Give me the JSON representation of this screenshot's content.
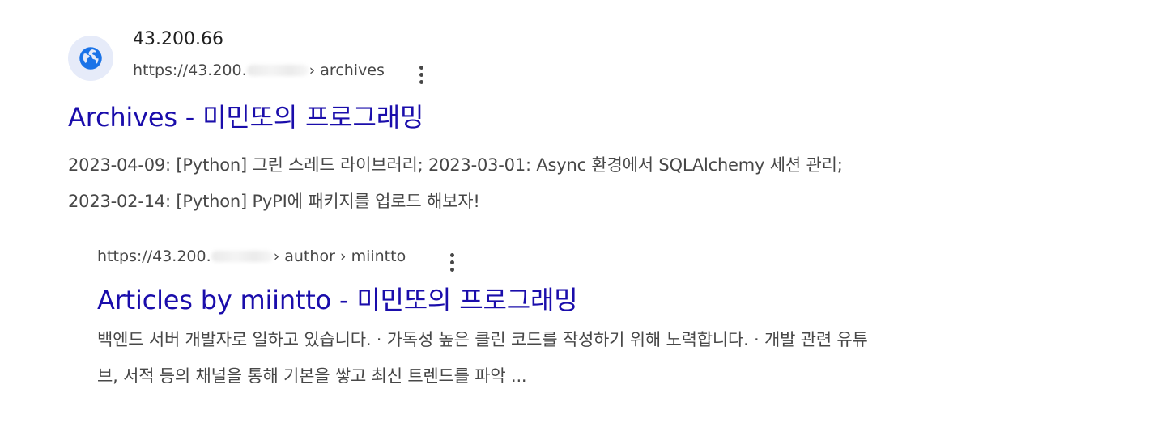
{
  "results": [
    {
      "site_name": "43.200.66",
      "url_prefix": "https://43.200.",
      "url_path": "› archives",
      "title": "Archives - 미민또의 프로그래밍",
      "snippet_lines": [
        "2023-04-09: [Python] 그린 스레드 라이브러리; 2023-03-01: Async 환경에서 SQLAlchemy 세션 관리;",
        "2023-02-14: [Python] PyPI에 패키지를 업로드 해보자!"
      ],
      "favicon_icon": "globe-icon",
      "menu_icon": "more-vert-icon"
    },
    {
      "url_prefix": "https://43.200.",
      "url_path": "› author › miintto",
      "title": "Articles by miintto - 미민또의 프로그래밍",
      "snippet_lines": [
        "백엔드 서버 개발자로 일하고 있습니다. · 가독성 높은 클린 코드를 작성하기 위해 노력합니다. · 개발 관련 유튜",
        "브, 서적 등의 채널을 통해 기본을 쌓고 최신 트렌드를 파악 ..."
      ],
      "menu_icon": "more-vert-icon"
    }
  ],
  "colors": {
    "title_link": "#1a0dab",
    "url_text": "#474747",
    "snippet_text": "#474747",
    "favicon_bg": "#e6ebf9",
    "favicon_fg": "#1a73e8"
  }
}
